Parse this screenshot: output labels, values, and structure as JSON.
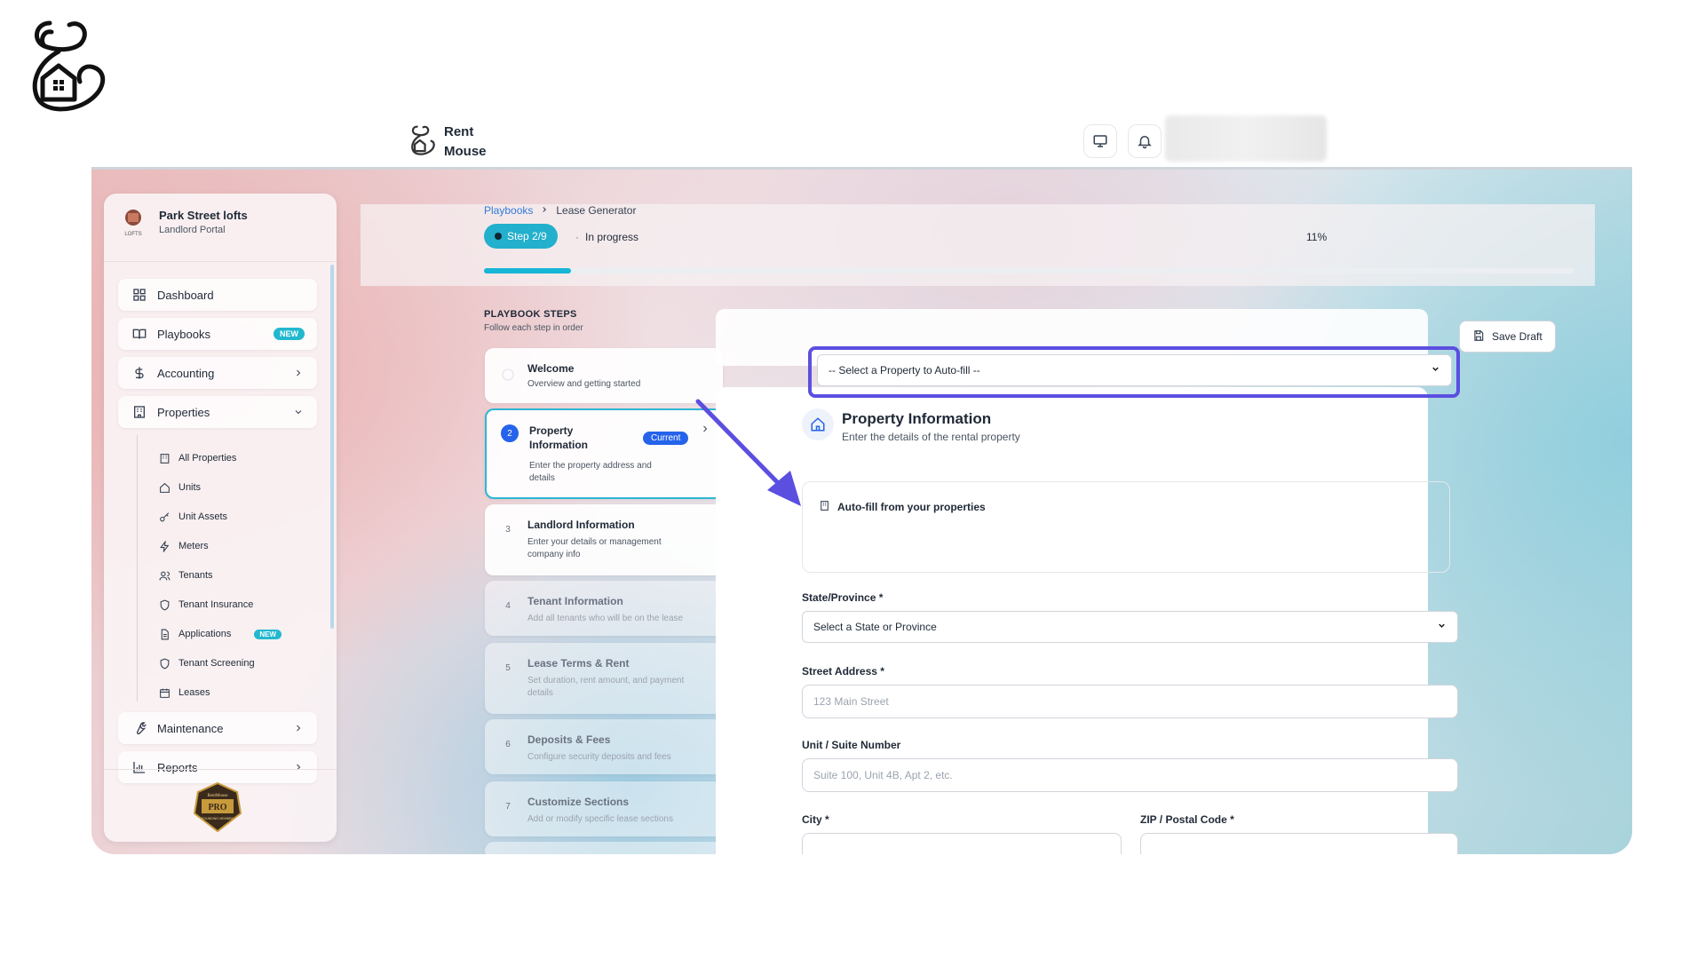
{
  "brand": {
    "name_line1": "Rent",
    "name_line2": "Mouse"
  },
  "org": {
    "name": "Park Street lofts",
    "subtitle": "Landlord Portal",
    "avatar_text": "LOFTS"
  },
  "nav": {
    "dashboard": "Dashboard",
    "playbooks": "Playbooks",
    "playbooks_badge": "NEW",
    "accounting": "Accounting",
    "properties": "Properties",
    "maintenance": "Maintenance",
    "reports": "Reports",
    "sub": {
      "all_properties": "All Properties",
      "units": "Units",
      "unit_assets": "Unit Assets",
      "meters": "Meters",
      "tenants": "Tenants",
      "tenant_insurance": "Tenant Insurance",
      "applications": "Applications",
      "applications_badge": "NEW",
      "tenant_screening": "Tenant Screening",
      "leases": "Leases"
    }
  },
  "badge_text": {
    "top": "RentMouse",
    "middle": "PRO",
    "bottom": "FOUNDING MEMBER"
  },
  "breadcrumb": {
    "parent": "Playbooks",
    "current": "Lease Generator"
  },
  "progress": {
    "step_label": "Step 2/9",
    "separator": "·",
    "status": "In progress",
    "percent_text": "11%",
    "percent": 8
  },
  "steps": {
    "title": "PLAYBOOK STEPS",
    "subtitle": "Follow each step in order",
    "items": [
      {
        "num": "",
        "title": "Welcome",
        "desc": "Overview and getting started"
      },
      {
        "num": "2",
        "title_line1": "Property",
        "title_line2": "Information",
        "badge": "Current",
        "desc_line1": "Enter the property address and",
        "desc_line2": "details"
      },
      {
        "num": "3",
        "title": "Landlord Information",
        "desc_line1": "Enter your details or management",
        "desc_line2": "company info"
      },
      {
        "num": "4",
        "title": "Tenant Information",
        "desc": "Add all tenants who will be on the lease"
      },
      {
        "num": "5",
        "title": "Lease Terms & Rent",
        "desc_line1": "Set duration, rent amount, and payment",
        "desc_line2": "details"
      },
      {
        "num": "6",
        "title": "Deposits & Fees",
        "desc": "Configure security deposits and fees"
      },
      {
        "num": "7",
        "title": "Customize Sections",
        "desc": "Add or modify specific lease sections"
      }
    ]
  },
  "toolbar": {
    "save_draft": "Save Draft"
  },
  "form": {
    "title": "Property Information",
    "subtitle": "Enter the details of the rental property",
    "autofill_label": "Auto-fill from your properties",
    "autofill_selected": "-- Select a Property to Auto-fill --",
    "state_label": "State/Province *",
    "state_selected": "Select a State or Province",
    "street_label": "Street Address *",
    "street_placeholder": "123 Main Street",
    "unit_label": "Unit / Suite Number",
    "unit_placeholder": "Suite 100, Unit 4B, Apt 2, etc.",
    "city_label": "City *",
    "zip_label": "ZIP / Postal Code *"
  },
  "colors": {
    "accent": "#22b0cc",
    "highlight": "#5b4fe0",
    "link": "#2f7bd9",
    "current_badge": "#2563eb"
  }
}
